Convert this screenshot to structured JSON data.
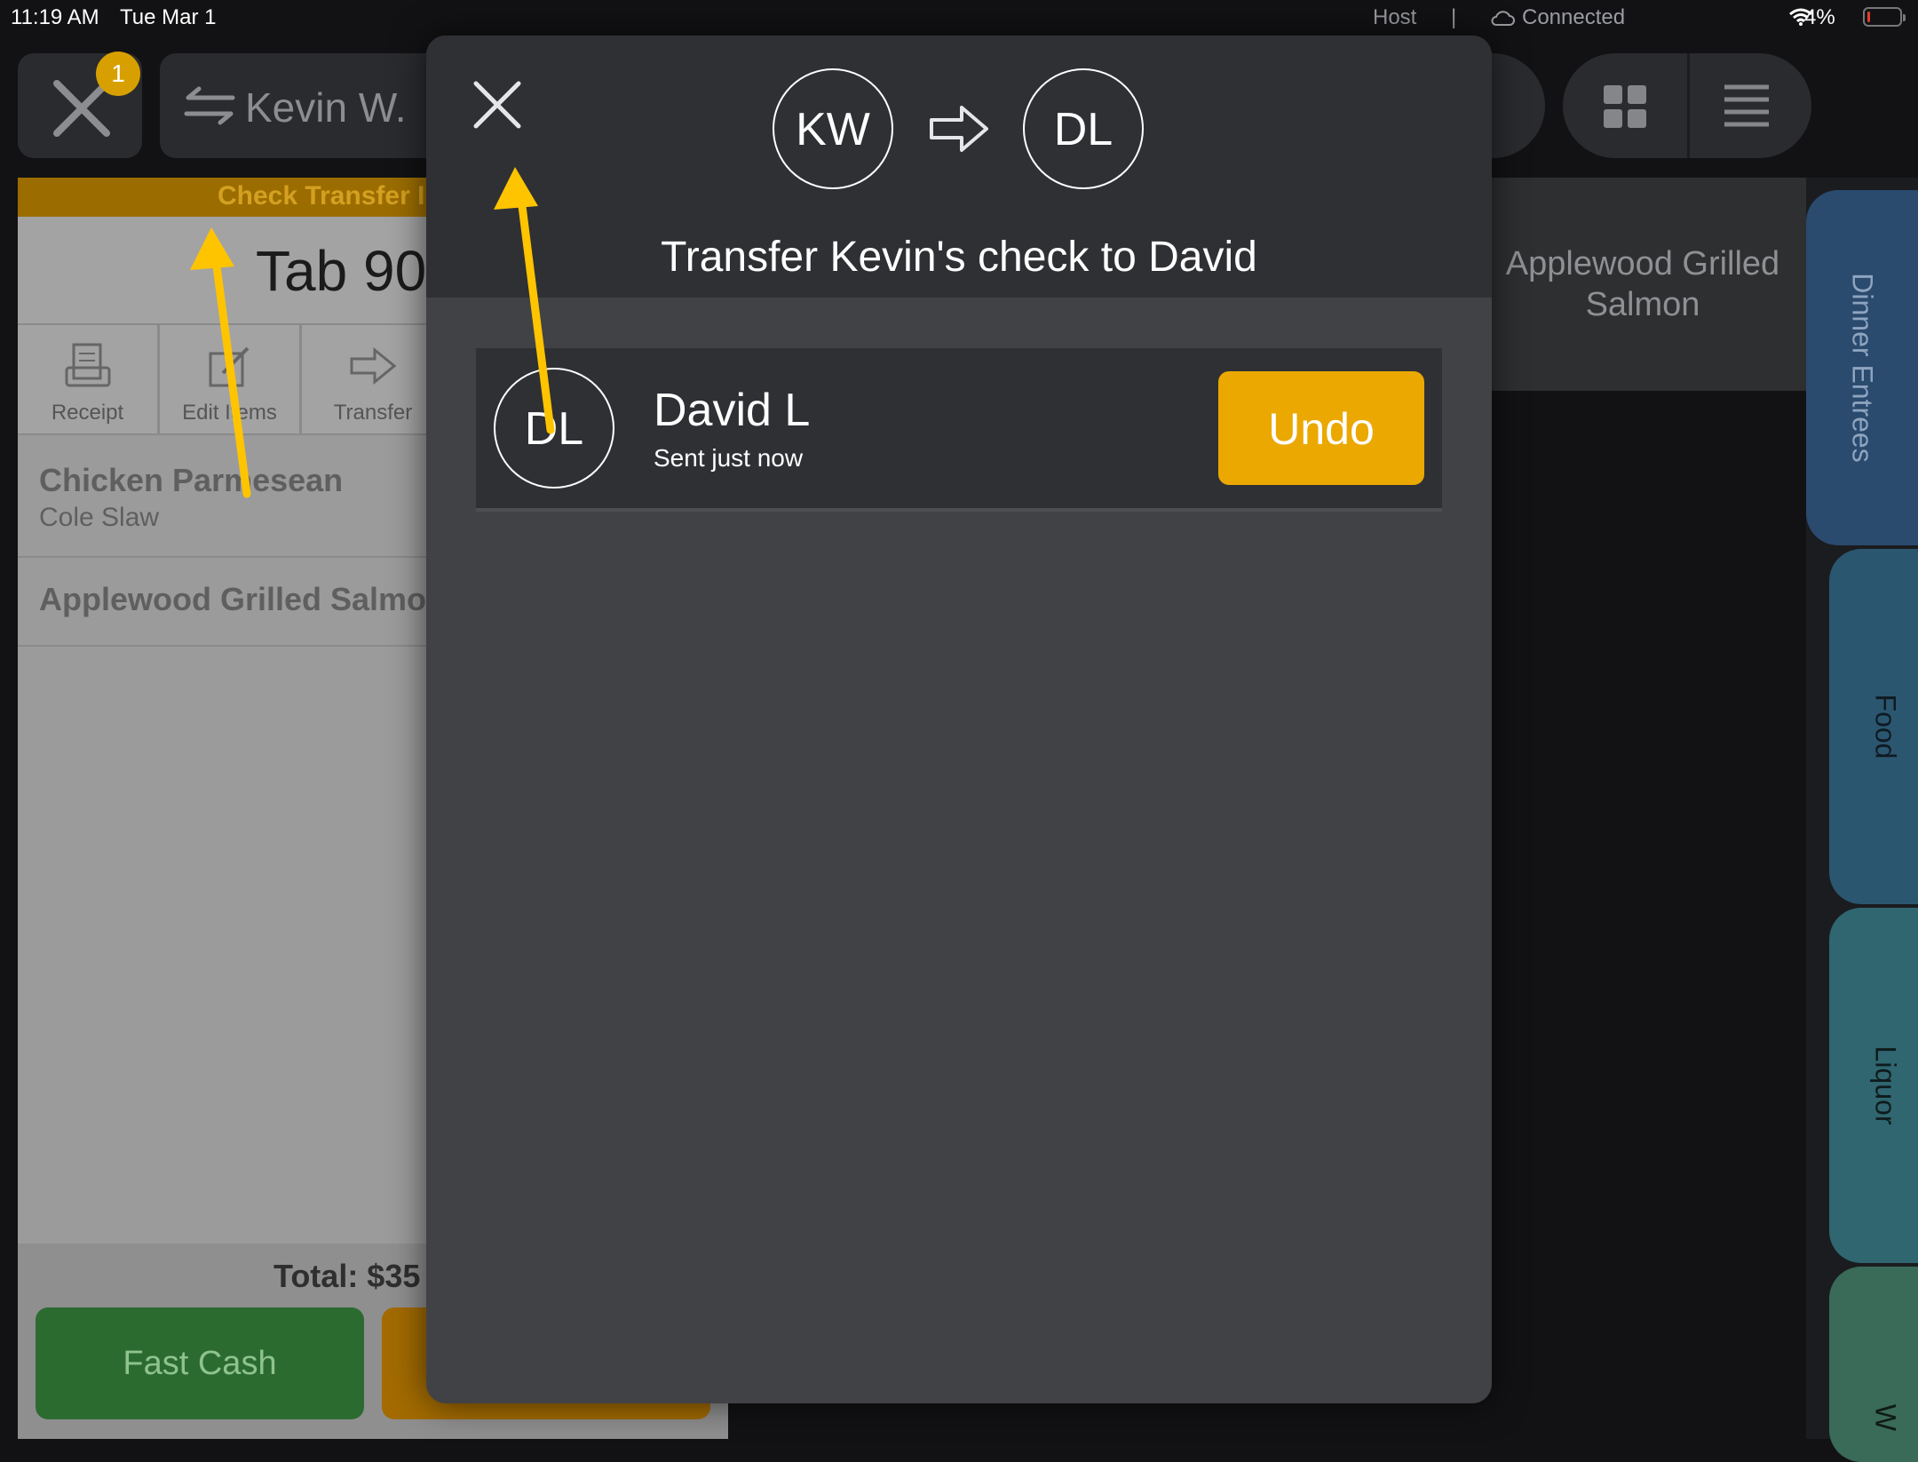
{
  "status_bar": {
    "time": "11:19 AM",
    "date": "Tue Mar 1",
    "role": "Host",
    "separator": "|",
    "connection": "Connected",
    "battery": "4%"
  },
  "top_bar": {
    "close_badge_count": "1",
    "server_name": "Kevin W."
  },
  "left_panel": {
    "banner": "Check Transfer I",
    "tab_title": "Tab 90",
    "tools": [
      {
        "label": "Receipt",
        "icon": "receipt-icon"
      },
      {
        "label": "Edit Items",
        "icon": "edit-items-icon"
      },
      {
        "label": "Transfer",
        "icon": "transfer-arrow-icon"
      }
    ],
    "items": [
      {
        "name": "Chicken Parmesean",
        "modifier": "Cole Slaw"
      },
      {
        "name": "Applewood Grilled Salmo",
        "modifier": ""
      }
    ],
    "total": "Total: $35",
    "fast_cash": "Fast Cash"
  },
  "menu": {
    "item_card": "Applewood Grilled Salmon",
    "categories": [
      {
        "label": "Dinner Entrees",
        "color": "#2a4a6e"
      },
      {
        "label": "Food",
        "color": "#2b5670"
      },
      {
        "label": "Liquor",
        "color": "#2f6670"
      },
      {
        "label": "W",
        "color": "#3a6a58"
      }
    ]
  },
  "modal": {
    "from_initials": "KW",
    "to_initials": "DL",
    "title": "Transfer Kevin's check to David",
    "transfer": {
      "initials": "DL",
      "name": "David L",
      "status": "Sent just now",
      "undo_label": "Undo"
    }
  },
  "colors": {
    "accent": "#eba800",
    "annotation_arrow": "#ffc400",
    "fast_cash": "#2c6b2f"
  }
}
